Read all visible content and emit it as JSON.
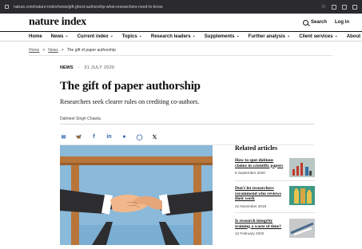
{
  "browser": {
    "url": "nature.com/nature-index/news/gift-ghost-authorship-what-researchers-need-to-know"
  },
  "header": {
    "logo": "nature index",
    "search_label": "Search",
    "login_label": "Log in"
  },
  "nav": {
    "items": [
      {
        "label": "Home",
        "dropdown": false
      },
      {
        "label": "News",
        "dropdown": true
      },
      {
        "label": "Current index",
        "dropdown": true
      },
      {
        "label": "Topics",
        "dropdown": true
      },
      {
        "label": "Research leaders",
        "dropdown": true
      },
      {
        "label": "Supplements",
        "dropdown": true
      },
      {
        "label": "Further analysis",
        "dropdown": true
      },
      {
        "label": "Client services",
        "dropdown": true
      },
      {
        "label": "About",
        "dropdown": true
      }
    ]
  },
  "breadcrumb": {
    "home": "Home",
    "news": "News",
    "current": "The gift of paper authorship",
    "separator": ">"
  },
  "article": {
    "category": "NEWS",
    "separator": "·",
    "date": "31 JULY 2020",
    "title": "The gift of paper authorship",
    "subtitle": "Researchers seek clearer rules on crediting co-authors.",
    "author": "Dalmeet Singh Chawla"
  },
  "share": {
    "icons": [
      "email-icon",
      "bluesky-icon",
      "facebook-icon",
      "linkedin-icon",
      "reddit-icon",
      "whatsapp-icon",
      "x-icon"
    ],
    "glyphs": [
      "✉",
      "🦋",
      "f",
      "in",
      "●",
      "◯",
      "𝕏"
    ]
  },
  "related": {
    "heading": "Related articles",
    "items": [
      {
        "title": "How to spot dubious claims in scientific papers",
        "date": "8 September 2020"
      },
      {
        "title": "Don't let researchers recommend who reviews their work",
        "date": "22 November 2019"
      },
      {
        "title": "Is research integrity training a waste of time?",
        "date": "12 February 2020"
      }
    ]
  },
  "colors": {
    "illustration_bg": "#8bb9d9",
    "table": "#b8753a",
    "sleeve": "#2d2d30",
    "hand": "#f2b88c",
    "share_blue": "#2b5fa8"
  }
}
